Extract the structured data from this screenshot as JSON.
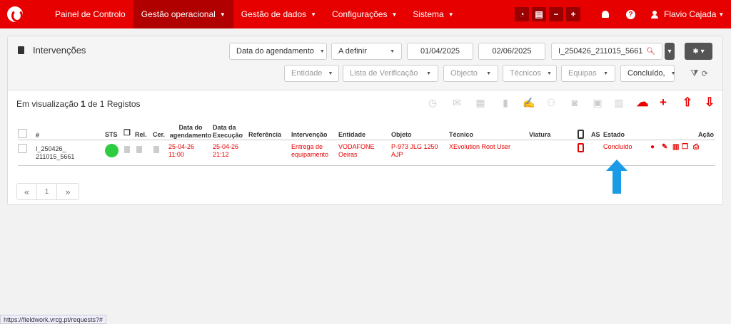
{
  "navbar": {
    "items": [
      {
        "label": "Painel de Controlo"
      },
      {
        "label": "Gestão operacional"
      },
      {
        "label": "Gestão de dados"
      },
      {
        "label": "Configurações"
      },
      {
        "label": "Sistema"
      }
    ],
    "minus": "−",
    "plus": "+",
    "help": "?",
    "user": "Flavio Cajada"
  },
  "filters": {
    "title": "Intervenções",
    "date_type": "Data do agendamento",
    "period": "A definir",
    "date_from": "01/04/2025",
    "date_to": "02/06/2025",
    "search": "I_250426_211015_5661",
    "entidade": "Entidade",
    "lista": "Lista de Verificação",
    "objecto": "Objecto",
    "tecnicos": "Técnicos",
    "equipas": "Equipas",
    "estado": "Concluído,"
  },
  "summary": {
    "prefix": "Em visualização",
    "shown": "1",
    "middle": "de",
    "total": "1",
    "suffix": "Registos"
  },
  "table": {
    "headers": {
      "num": "#",
      "sts": "STS",
      "rel": "Rel.",
      "cer": "Cer.",
      "data_agend": "Data do agendamento",
      "data_exec": "Data da Execução",
      "referencia": "Referência",
      "intervencao": "Intervenção",
      "entidade": "Entidade",
      "objeto": "Objeto",
      "tecnico": "Técnico",
      "viatura": "Viatura",
      "as": "AS",
      "estado": "Estado",
      "acao": "Ação"
    },
    "rows": [
      {
        "num_line1": "I_250426_",
        "num_line2": "211015_5661",
        "agend_date": "25-04-26",
        "agend_time": "11:00",
        "exec_date": "25-04-26",
        "exec_time": "21:12",
        "intervencao_l1": "Entrega de",
        "intervencao_l2": "equipamento",
        "entidade_l1": "VODAFONE",
        "entidade_l2": "Oeiras",
        "objeto_l1": "P-973 JLG 1250",
        "objeto_l2": "AJP",
        "tecnico": "XEvolution Root User",
        "estado": "Concluído"
      }
    ]
  },
  "pagination": {
    "prev": "«",
    "page": "1",
    "next": "»"
  },
  "status_bar": "https://fieldwork.vrcg.pt/requests?#",
  "colors": {
    "brand": "#e60000",
    "status_dot": "#2ecc40",
    "arrow": "#1a9be6"
  }
}
